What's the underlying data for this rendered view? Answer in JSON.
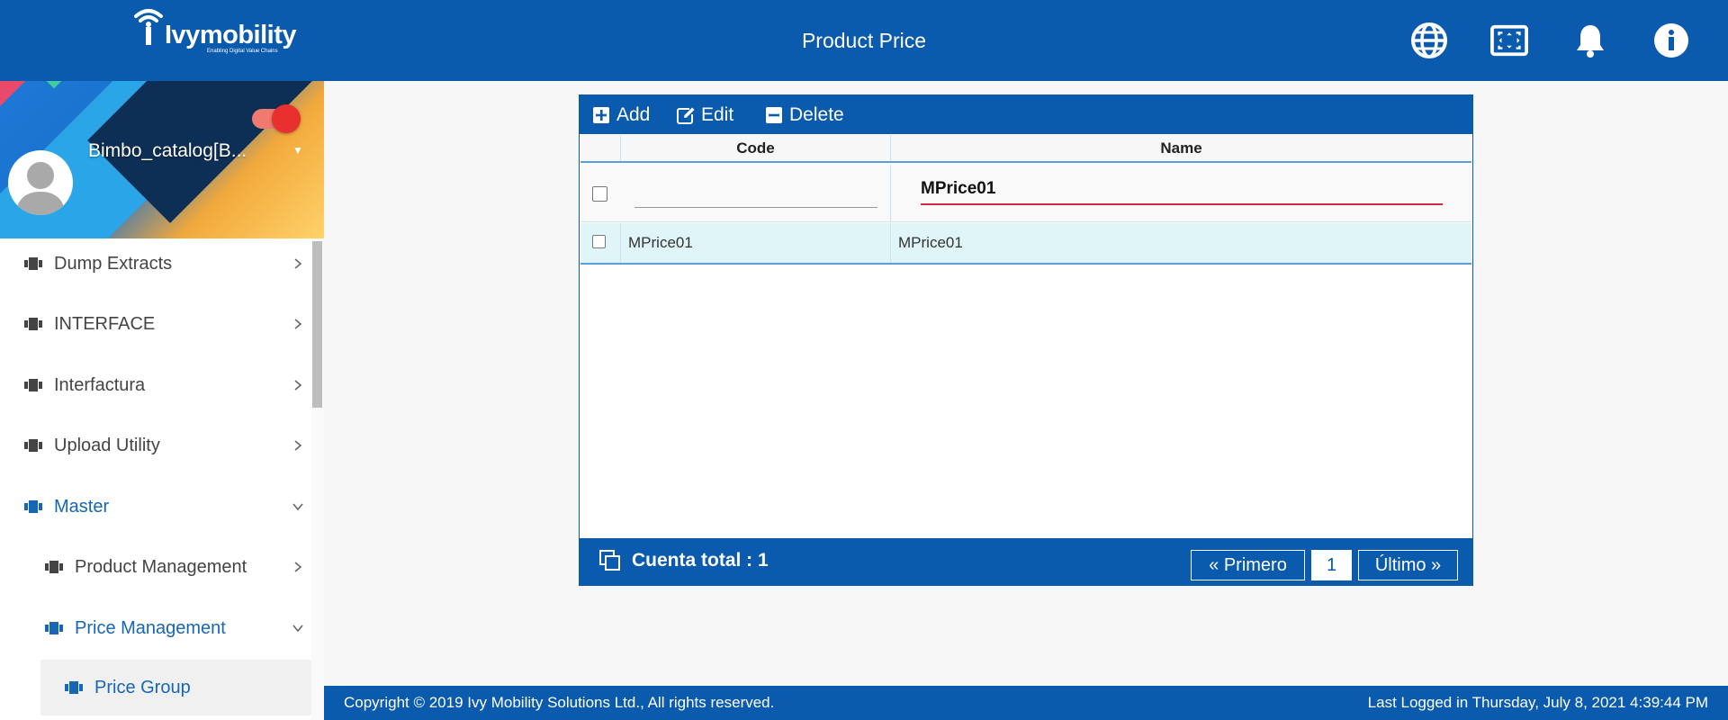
{
  "header": {
    "logo_text": "Ivymobility",
    "logo_tagline": "Enabling Digital Value Chains",
    "title": "Product Price",
    "icons": [
      "globe-icon",
      "fullscreen-icon",
      "bell-icon",
      "info-icon"
    ]
  },
  "profile": {
    "username": "Bimbo_catalog[B...",
    "toggle_on": true
  },
  "sidebar": {
    "items": [
      {
        "label": "Dump Extracts",
        "state": "collapsed"
      },
      {
        "label": "INTERFACE",
        "state": "collapsed"
      },
      {
        "label": "Interfactura",
        "state": "collapsed"
      },
      {
        "label": "Upload Utility",
        "state": "collapsed"
      },
      {
        "label": "Master",
        "state": "expanded"
      },
      {
        "label": "Product Management",
        "state": "collapsed"
      },
      {
        "label": "Price Management",
        "state": "expanded"
      },
      {
        "label": "Price Group",
        "state": "selected"
      }
    ]
  },
  "toolbar": {
    "add_label": "Add",
    "edit_label": "Edit",
    "delete_label": "Delete"
  },
  "grid": {
    "columns": [
      "Code",
      "Name"
    ],
    "filters": {
      "code_value": "",
      "name_value": "MPrice01"
    },
    "rows": [
      {
        "code": "MPrice01",
        "name": "MPrice01"
      }
    ]
  },
  "grid_footer": {
    "count_text": "Cuenta total : 1",
    "first_label": "« Primero",
    "current_page": "1",
    "last_label": "Último »"
  },
  "footer": {
    "copyright": "Copyright © 2019 Ivy Mobility Solutions Ltd., All rights reserved.",
    "last_logged": "Last Logged in Thursday, July 8, 2021 4:39:44 PM"
  },
  "colors": {
    "brand_blue": "#0a5aad",
    "active_nav": "#1566b5",
    "toggle_red": "#e8302f",
    "row_highlight": "#e0f5f8",
    "input_focus": "#d9263f"
  }
}
